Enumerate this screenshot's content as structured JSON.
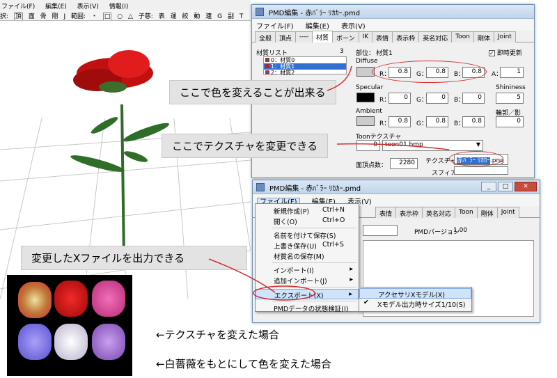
{
  "background_app": {
    "menu": [
      "ファイル(F)",
      "編集(E)",
      "表示(V)",
      "情報(I)"
    ],
    "toolbar": [
      "択:",
      "頂",
      "面",
      "骨",
      "剛",
      "J",
      "範囲:",
      "・",
      "□",
      "○",
      "△",
      "子慈:",
      "表",
      "運",
      "絞",
      "動",
      "連",
      "G",
      "副",
      "T"
    ]
  },
  "editor_top": {
    "title": "PMD編集 - 赤ﾊﾞﾗｰ ﾘｶｶｰ.pmd",
    "menu": [
      "ファイル(F)",
      "編集(E)",
      "表示(V)"
    ],
    "tabs": [
      "全般",
      "頂点",
      "----",
      "材質",
      "ボーン",
      "IK",
      "表情",
      "表示枠",
      "英名対応",
      "Toon",
      "剛体",
      "Joint"
    ],
    "active_tab": "材質",
    "material_list_label": "材質リスト",
    "material_count": "3",
    "materials": [
      "0：材質0",
      "1：材質1",
      "2：材質2"
    ],
    "selected_material": 1,
    "part_label": "部位：",
    "part_value": "材質1",
    "instant_update_label": "即時更新",
    "diffuse_label": "Diffuse",
    "diffuse": {
      "r": "0.8",
      "g": "0.8",
      "b": "0.8",
      "a": "1"
    },
    "specular_label": "Specular",
    "specular": {
      "r": "0",
      "g": "0",
      "b": "0"
    },
    "shininess_label": "Shininess",
    "shininess": "5",
    "ambient_label": "Ambient",
    "ambient": {
      "r": "0.8",
      "g": "0.8",
      "b": "0.8"
    },
    "edge_label": "輪郭／影",
    "edge_value": "0",
    "toon_label": "Toonテクスチャ",
    "toon_index": "0",
    "toon_file": "toon01.bmp",
    "vertex_count_label": "面頂点数：",
    "vertex_count": "2280",
    "texture_label": "テクスチャ",
    "texture_selected": "赤ﾊﾞﾗｰ ﾘｶｶｰ",
    "texture_ext": ".png",
    "sphere_label": "スフィア：",
    "channel_labels": {
      "r": "R：",
      "g": "G：",
      "b": "B：",
      "a": "A："
    }
  },
  "editor_bottom": {
    "title": "PMD編集 - 赤ﾊﾞﾗｰ ﾘｶｶｰ.pmd",
    "menu": [
      "ファイル(F)",
      "編集(E)",
      "表示(V)"
    ],
    "tabs_visible": [
      "表情",
      "表示枠",
      "英名対応",
      "Toon",
      "剛体",
      "Joint"
    ],
    "pmd_version_label": "PMDバージョン",
    "pmd_version": "1.00",
    "file_menu": [
      {
        "label": "新規作成(P)",
        "shortcut": "Ctrl+N"
      },
      {
        "label": "開く(O)",
        "shortcut": "Ctrl+O"
      },
      {
        "sep": true
      },
      {
        "label": "名前を付けて保存(S)",
        "shortcut": ""
      },
      {
        "label": "上書き保存(U)",
        "shortcut": "Ctrl+S"
      },
      {
        "label": "材質名の保存(M)",
        "shortcut": ""
      },
      {
        "sep": true
      },
      {
        "label": "インポート(I)",
        "submenu": true
      },
      {
        "label": "追加インポート(J)",
        "submenu": true
      },
      {
        "sep": true
      },
      {
        "label": "エクスポート(X)",
        "submenu": true,
        "highlight": true
      },
      {
        "sep": true
      },
      {
        "label": "PMDデータの状態検証(I)",
        "shortcut": ""
      }
    ],
    "export_submenu": [
      "アクセサリXモデル(X)",
      "Xモデル出力時サイズ1/10(S)"
    ],
    "export_checked": 1
  },
  "annotations": {
    "color_change": "ここで色を変えることが出来る",
    "texture_change": "ここでテクスチャを変更できる",
    "x_export": "変更したXファイルを出力できる",
    "texture_case": "←テクスチャを変えた場合",
    "white_rose_case": "←白薔薇をもとにして色を変えた場合"
  },
  "thumbnail_colors": [
    "#e8c07a",
    "#d01010",
    "#d23a8c",
    "#7a70e0",
    "#d8d0e8",
    "#9a66c8"
  ]
}
